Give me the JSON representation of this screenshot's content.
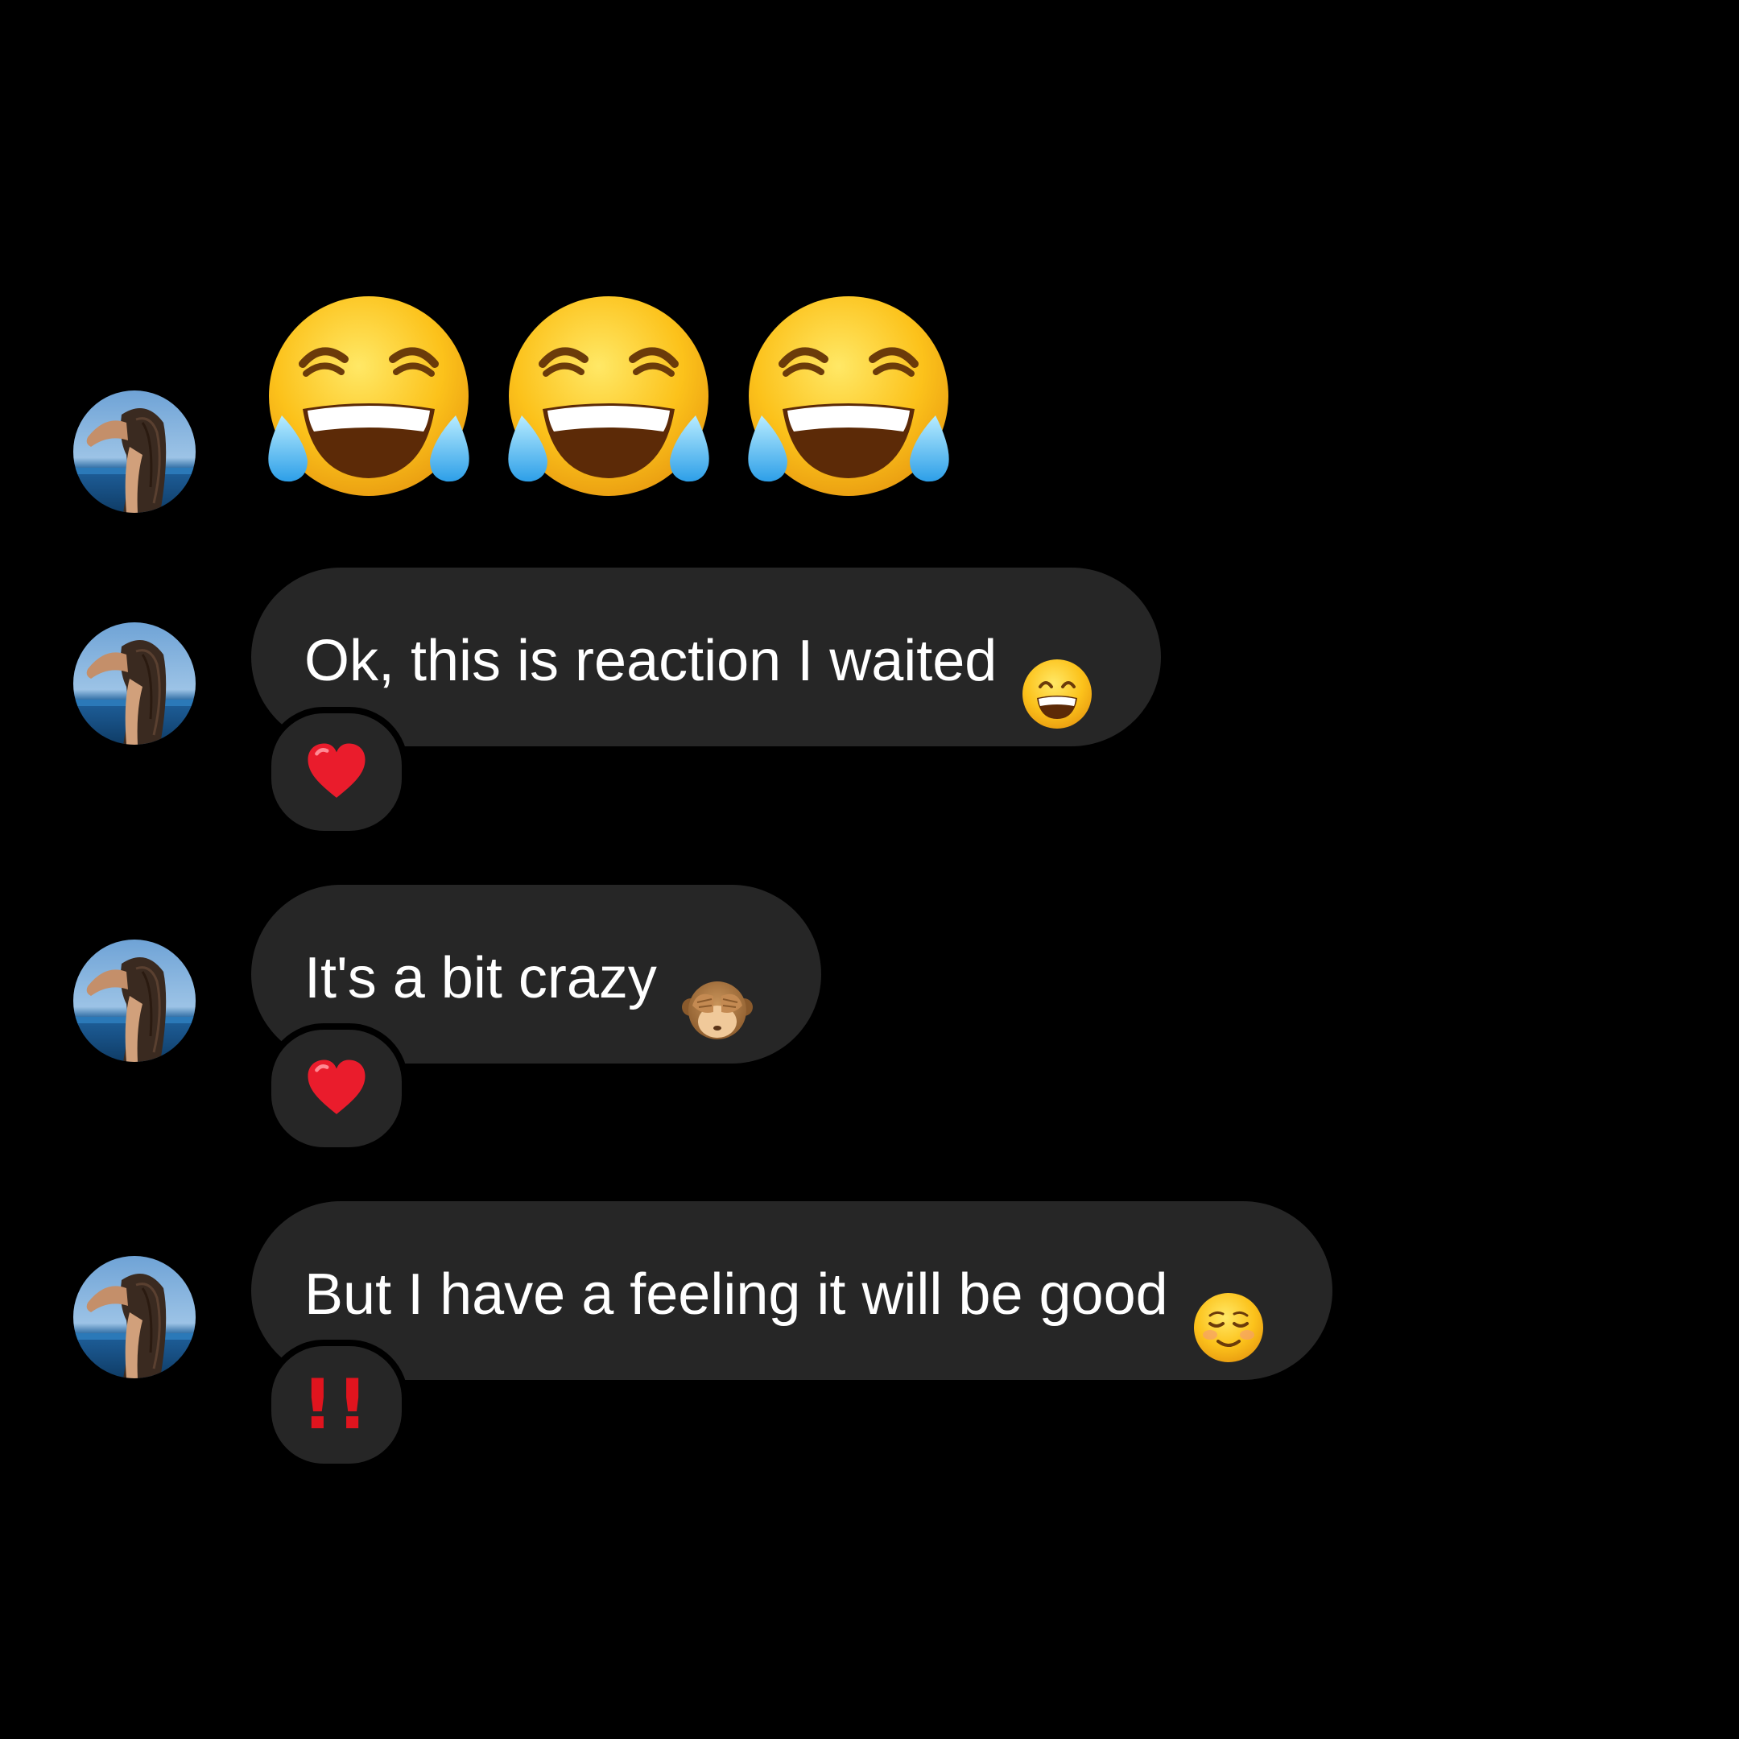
{
  "messages": [
    {
      "type": "emoji",
      "emojis": [
        "face-with-tears-of-joy",
        "face-with-tears-of-joy",
        "face-with-tears-of-joy"
      ]
    },
    {
      "type": "text",
      "text": "Ok, this is reaction I waited",
      "emoji": "grinning-face-with-smiling-eyes",
      "reaction": "red-heart"
    },
    {
      "type": "text",
      "text": "It's a bit crazy",
      "emoji": "see-no-evil-monkey",
      "reaction": "red-heart"
    },
    {
      "type": "text",
      "text": "But I have a feeling it will be good",
      "emoji": "smiling-face",
      "reaction": "double-exclamation",
      "reaction_text": "!!"
    }
  ],
  "colors": {
    "background": "#000000",
    "bubble": "#262626",
    "text": "#ffffff",
    "reaction_red": "#e0141e"
  }
}
